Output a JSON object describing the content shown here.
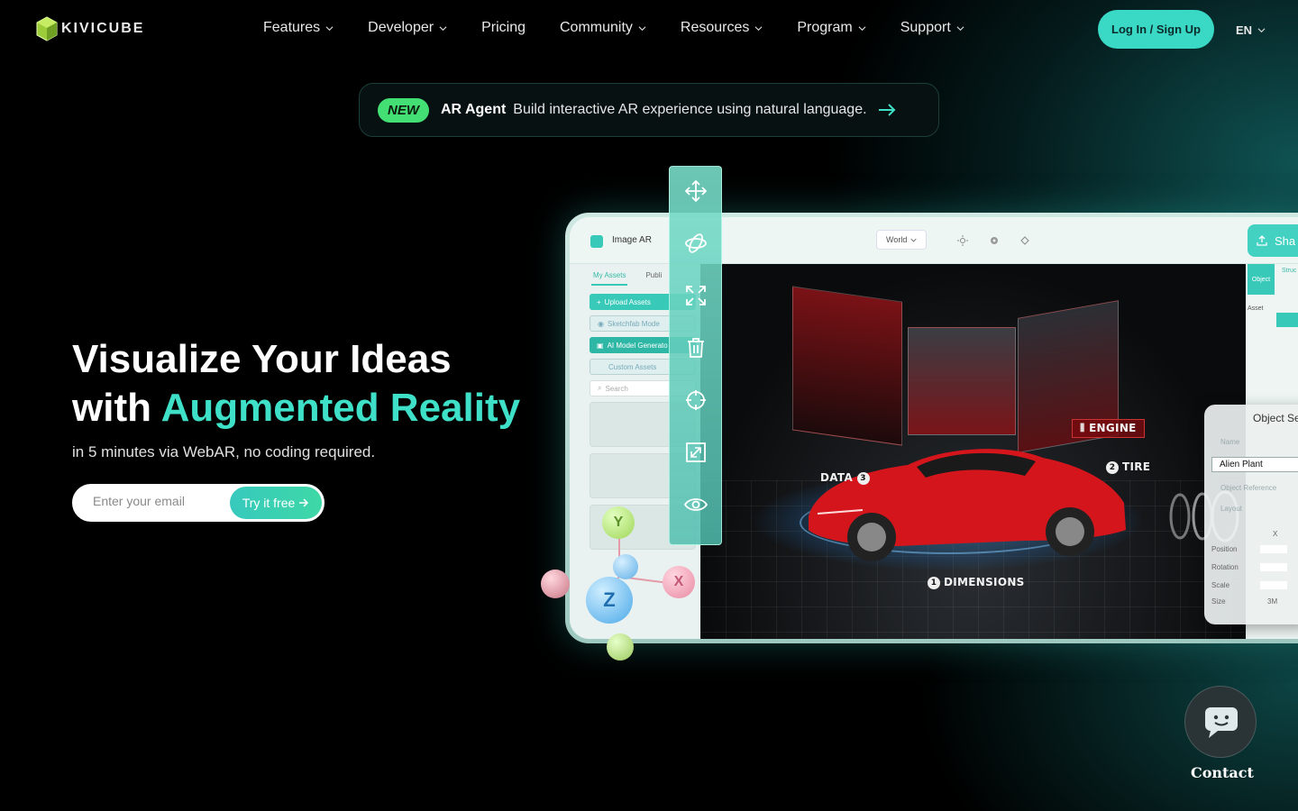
{
  "brand": {
    "name": "KIVICUBE"
  },
  "nav": {
    "items": [
      {
        "label": "Features",
        "has_dropdown": true
      },
      {
        "label": "Developer",
        "has_dropdown": true
      },
      {
        "label": "Pricing",
        "has_dropdown": false
      },
      {
        "label": "Community",
        "has_dropdown": true
      },
      {
        "label": "Resources",
        "has_dropdown": true
      },
      {
        "label": "Program",
        "has_dropdown": true
      },
      {
        "label": "Support",
        "has_dropdown": true
      }
    ],
    "login_label": "Log In / Sign Up",
    "language": "EN"
  },
  "banner": {
    "badge": "NEW",
    "title": "AR Agent",
    "description": "Build interactive AR experience using natural language."
  },
  "hero": {
    "title_line1": "Visualize Your Ideas",
    "title_line2_prefix": "with ",
    "title_line2_accent": "Augmented Reality",
    "subtitle": "in 5 minutes via WebAR, no coding required.",
    "email_placeholder": "Enter your email",
    "cta_label": "Try it free"
  },
  "editor": {
    "project_name": "Image AR",
    "space_mode": "World",
    "share_label": "Sha",
    "tabs": [
      "My Assets",
      "Publi"
    ],
    "upload_label": "Upload Assets",
    "sketchfab_label": "Sketchfab Mode",
    "ai_generator_label": "AI Model Generato",
    "custom_assets_label": "Custom Assets",
    "search_placeholder": "Search",
    "right_tabs": [
      "Object",
      "Asset",
      "Struc"
    ],
    "scene_labels": {
      "engine": "ENGINE",
      "tire": "TIRE",
      "data": "DATA",
      "dimensions": "DIMENSIONS",
      "tire_number": "2",
      "dimensions_number": "1",
      "data_number": "3"
    },
    "object_settings": {
      "title": "Object Se",
      "name_label": "Name",
      "name_value": "Alien Plant",
      "object_reference": "Object Reference",
      "layout": "Layout",
      "axis_x": "X",
      "rows": [
        "Position",
        "Rotation",
        "Scale",
        "Size"
      ],
      "size_value": "3M"
    },
    "gizmo_axes": {
      "y": "Y",
      "x": "X",
      "z": "Z"
    },
    "tools": [
      "move-icon",
      "rotate-icon",
      "scale-icon",
      "trash-icon",
      "target-icon",
      "fit-icon",
      "eye-icon"
    ]
  },
  "contact": {
    "label": "Contact"
  },
  "colors": {
    "accent": "#3fe0c8",
    "login_bg": "#39d9c6",
    "new_badge": "#43df74",
    "car_red": "#d4161c"
  }
}
